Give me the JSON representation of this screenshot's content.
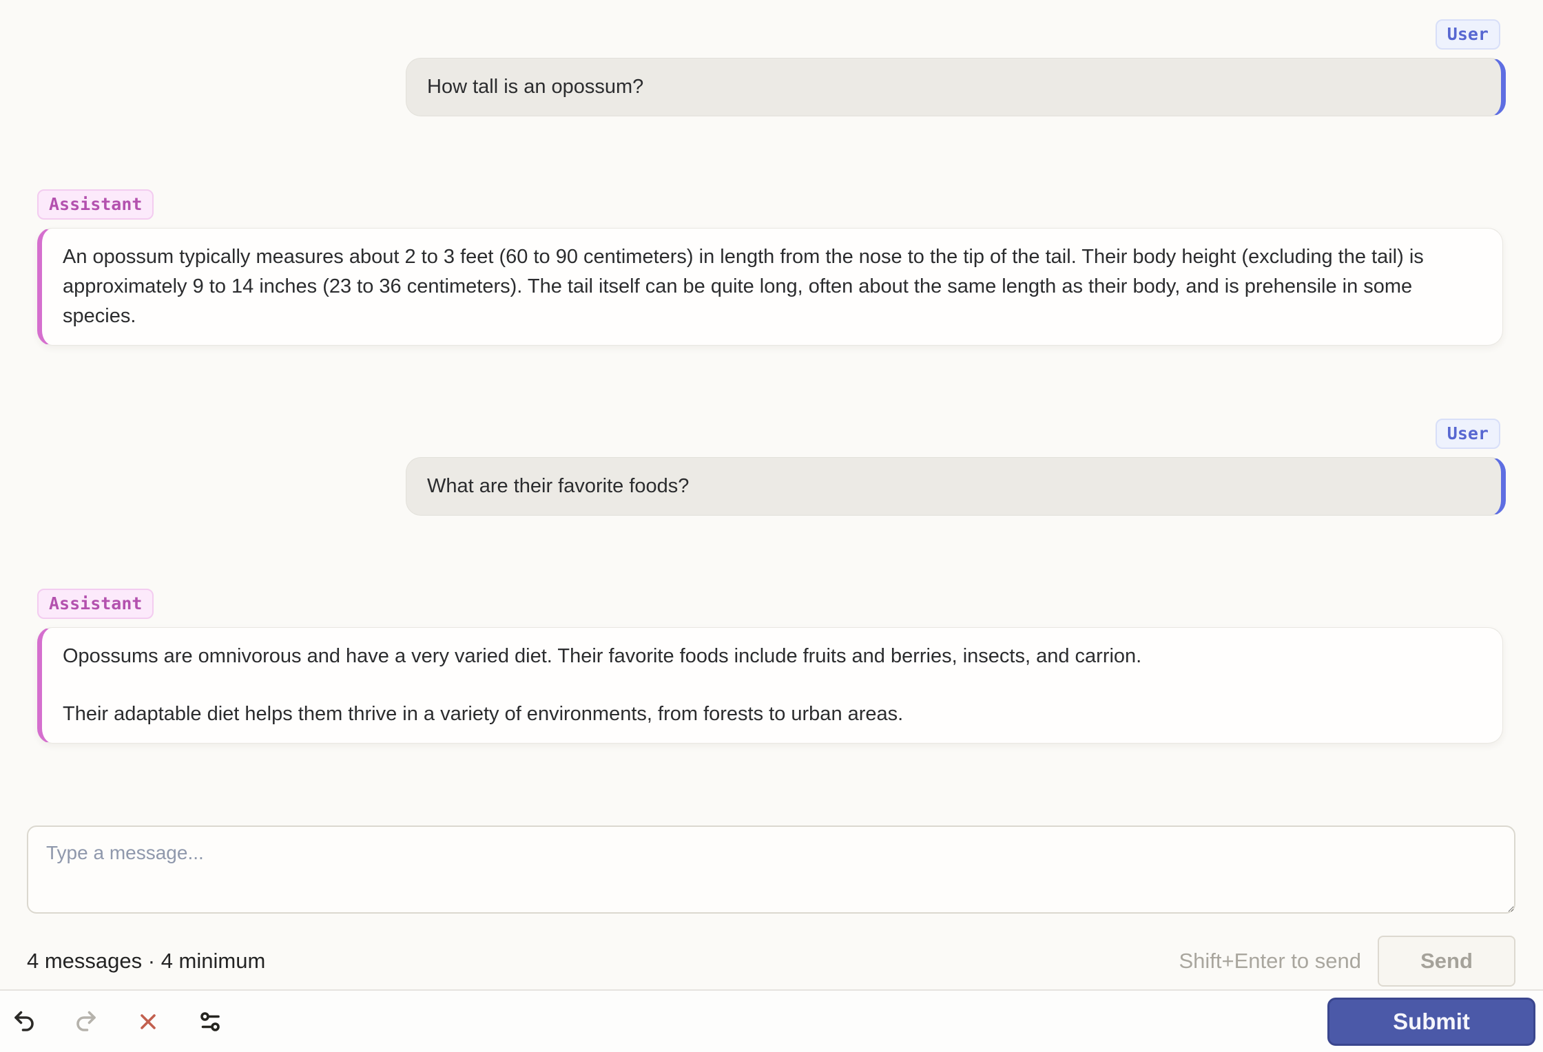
{
  "messages": [
    {
      "role": "User",
      "paragraphs": [
        "How tall is an opossum?"
      ]
    },
    {
      "role": "Assistant",
      "paragraphs": [
        "An opossum typically measures about 2 to 3 feet (60 to 90 centimeters) in length from the nose to the tip of the tail. Their body height (excluding the tail) is approximately 9 to 14 inches (23 to 36 centimeters). The tail itself can be quite long, often about the same length as their body, and is prehensile in some species."
      ]
    },
    {
      "role": "User",
      "paragraphs": [
        "What are their favorite foods?"
      ]
    },
    {
      "role": "Assistant",
      "paragraphs": [
        "Opossums are omnivorous and have a very varied diet. Their favorite foods include fruits and berries, insects, and carrion.",
        "Their adaptable diet helps them thrive in a variety of environments, from forests to urban areas."
      ]
    }
  ],
  "composer": {
    "placeholder": "Type a message...",
    "status": "4 messages · 4 minimum",
    "hint": "Shift+Enter to send",
    "send_label": "Send"
  },
  "footer": {
    "icons": [
      "undo-icon",
      "redo-icon",
      "close-icon",
      "settings-icon"
    ],
    "submit_label": "Submit"
  },
  "colors": {
    "user_accent": "#5e6ee2",
    "assistant_accent": "#d56fce",
    "user_badge_text": "#5767d1",
    "assistant_badge_text": "#b351ae",
    "submit_bg": "#4b59a8",
    "close_icon": "#c2604e",
    "page_bg": "#fbfaf7"
  }
}
